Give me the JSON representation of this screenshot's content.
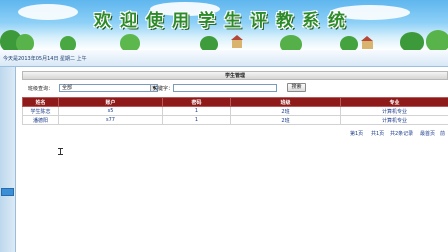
{
  "banner": {
    "title": "欢迎使用学生评教系统"
  },
  "status_bar": {
    "text": "今天是2013年05月14日    星期二    上午"
  },
  "panel": {
    "title": "学生管理",
    "class_query_label": "班级查询：",
    "class_select_value": "全部",
    "keyword_label": "关键字：",
    "keyword_value": "",
    "search_button": "搜索"
  },
  "table": {
    "columns": [
      "姓名",
      "账户",
      "密码",
      "班级",
      "专业"
    ],
    "rows": [
      [
        "学生陈志",
        "s5",
        "1",
        "2班",
        "计算机专业"
      ],
      [
        "潘德阳",
        "s77",
        "1",
        "2班",
        "计算机专业"
      ]
    ]
  },
  "pager": {
    "first": "第1页",
    "total": "共1页",
    "count": "共2条记录",
    "home": "最首页",
    "prev": "前"
  },
  "colors": {
    "table_header": "#8e1a1a",
    "banner_title": "#2d8a2a",
    "sidebar_accent": "#3a8fd6"
  }
}
